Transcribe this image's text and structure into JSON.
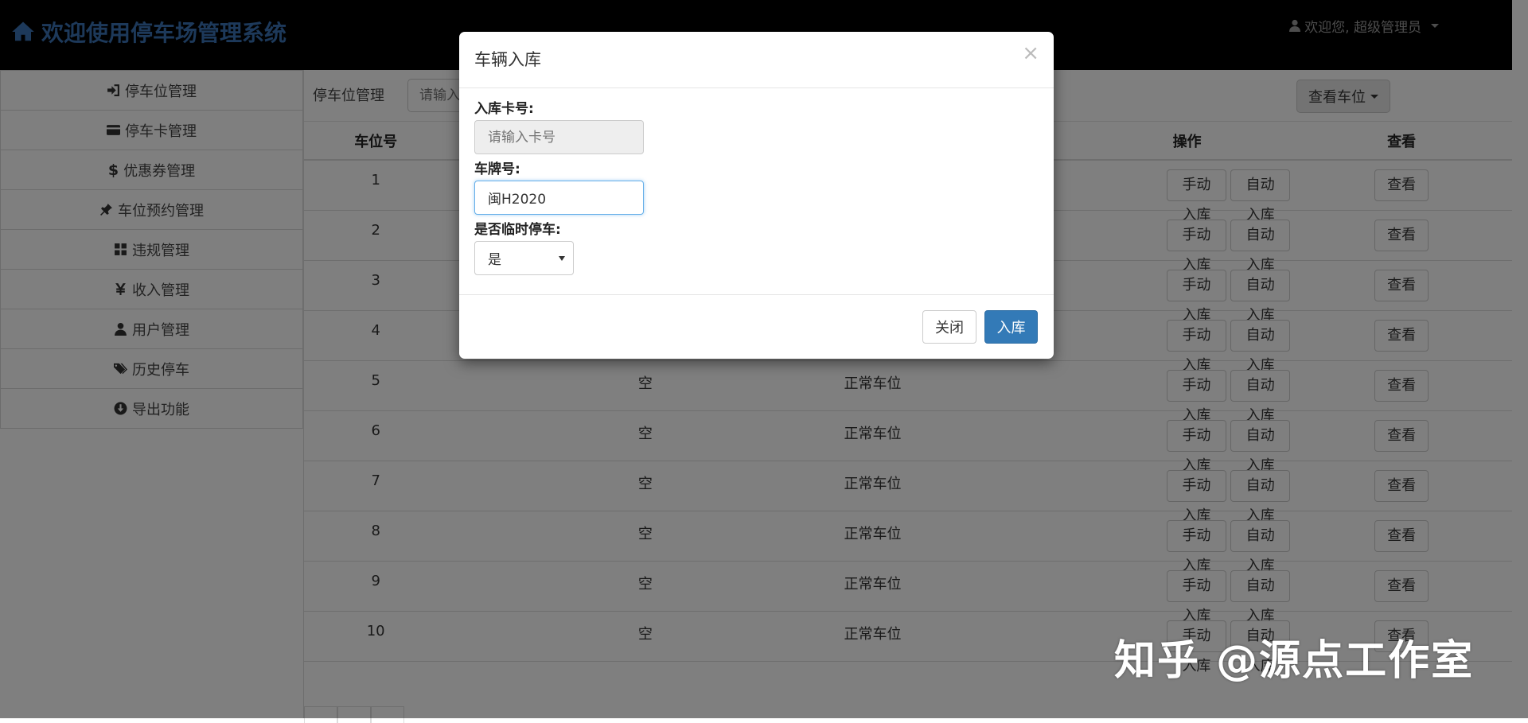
{
  "app": {
    "title": "欢迎使用停车场管理系统",
    "brand_color": "#3a72b5"
  },
  "user_menu": {
    "label": "欢迎您, 超级管理员"
  },
  "sidebar": {
    "items": [
      {
        "label": "停车位管理",
        "icon": "sign-in-icon"
      },
      {
        "label": "停车卡管理",
        "icon": "credit-card-icon"
      },
      {
        "label": "优惠券管理",
        "icon": "dollar-icon"
      },
      {
        "label": "车位预约管理",
        "icon": "pushpin-icon"
      },
      {
        "label": "违规管理",
        "icon": "grid-icon"
      },
      {
        "label": "收入管理",
        "icon": "yen-icon"
      },
      {
        "label": "用户管理",
        "icon": "user-icon"
      },
      {
        "label": "历史停车",
        "icon": "tags-icon"
      },
      {
        "label": "导出功能",
        "icon": "download-circle-icon"
      }
    ]
  },
  "toolbar": {
    "label": "停车位管理",
    "search_placeholder": "请输入",
    "view_button": "查看车位"
  },
  "table": {
    "headers": {
      "no": "车位号",
      "ops": "操作",
      "view": "查看"
    },
    "rows": [
      {
        "no": "1",
        "status": "",
        "type": ""
      },
      {
        "no": "2",
        "status": "",
        "type": ""
      },
      {
        "no": "3",
        "status": "",
        "type": ""
      },
      {
        "no": "4",
        "status": "",
        "type": ""
      },
      {
        "no": "5",
        "status": "空",
        "type": "正常车位"
      },
      {
        "no": "6",
        "status": "空",
        "type": "正常车位"
      },
      {
        "no": "7",
        "status": "空",
        "type": "正常车位"
      },
      {
        "no": "8",
        "status": "空",
        "type": "正常车位"
      },
      {
        "no": "9",
        "status": "空",
        "type": "正常车位"
      },
      {
        "no": "10",
        "status": "空",
        "type": "正常车位"
      }
    ],
    "btn_manual": "手动入库",
    "btn_auto": "自动入库",
    "btn_view": "查看"
  },
  "modal": {
    "title": "车辆入库",
    "close_glyph": "×",
    "card_label": "入库卡号:",
    "card_placeholder": "请输入卡号",
    "plate_label": "车牌号:",
    "plate_value": "闽H2020",
    "temp_label": "是否临时停车:",
    "temp_value": "是",
    "btn_close": "关闭",
    "btn_submit": "入库",
    "primary_color": "#337ab7"
  },
  "watermark": "知乎 @源点工作室"
}
